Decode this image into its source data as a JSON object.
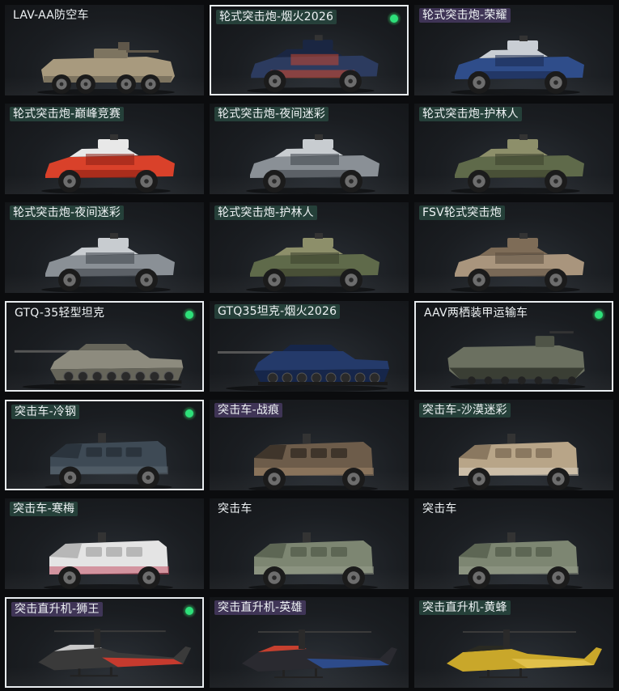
{
  "vehicles": [
    {
      "label": "LAV-AA防空车",
      "tag": "plain",
      "selected": false,
      "equipped": false,
      "type": "apc8",
      "colors": [
        "#a89a7e",
        "#7d7460",
        "#5f574a"
      ]
    },
    {
      "label": "轮式突击炮-烟火2026",
      "tag": "green",
      "selected": true,
      "equipped": true,
      "type": "assault",
      "colors": [
        "#2c3b5f",
        "#1a2642",
        "#c7472f"
      ]
    },
    {
      "label": "轮式突击炮-荣耀",
      "tag": "purple",
      "selected": false,
      "equipped": false,
      "type": "assault",
      "colors": [
        "#2f4d8a",
        "#c9ced4",
        "#1a2a4e"
      ]
    },
    {
      "label": "轮式突击炮-巅峰竞赛",
      "tag": "green",
      "selected": false,
      "equipped": false,
      "type": "assault",
      "colors": [
        "#d9412a",
        "#e8e8e8",
        "#8a1f14"
      ]
    },
    {
      "label": "轮式突击炮-夜间迷彩",
      "tag": "green",
      "selected": false,
      "equipped": false,
      "type": "assault",
      "colors": [
        "#8a9096",
        "#c8ccd0",
        "#3d4248"
      ]
    },
    {
      "label": "轮式突击炮-护林人",
      "tag": "green",
      "selected": false,
      "equipped": false,
      "type": "assault",
      "colors": [
        "#5f6a4a",
        "#8d8f6a",
        "#3a3f2c"
      ]
    },
    {
      "label": "轮式突击炮-夜间迷彩",
      "tag": "green",
      "selected": false,
      "equipped": false,
      "type": "assault",
      "colors": [
        "#8a9096",
        "#c8ccd0",
        "#3d4248"
      ]
    },
    {
      "label": "轮式突击炮-护林人",
      "tag": "green",
      "selected": false,
      "equipped": false,
      "type": "assault",
      "colors": [
        "#5f6a4a",
        "#8d8f6a",
        "#3a3f2c"
      ]
    },
    {
      "label": "FSV轮式突击炮",
      "tag": "green",
      "selected": false,
      "equipped": false,
      "type": "assault",
      "colors": [
        "#a9957d",
        "#7e6c57",
        "#5a4d3e"
      ]
    },
    {
      "label": "GTQ-35轻型坦克",
      "tag": "plain",
      "selected": true,
      "equipped": true,
      "type": "tank",
      "colors": [
        "#8d8b7e",
        "#66655a",
        "#4a4940"
      ]
    },
    {
      "label": "GTQ35坦克-烟火2026",
      "tag": "green",
      "selected": false,
      "equipped": false,
      "type": "tank",
      "colors": [
        "#243a6a",
        "#16264a",
        "#c7472f"
      ]
    },
    {
      "label": "AAV两栖装甲运输车",
      "tag": "plain",
      "selected": true,
      "equipped": true,
      "type": "amphib",
      "colors": [
        "#6b7060",
        "#4f5447",
        "#3a3e34"
      ]
    },
    {
      "label": "突击车-冷钢",
      "tag": "green",
      "selected": true,
      "equipped": true,
      "type": "mrap",
      "colors": [
        "#3e4a55",
        "#2b343d",
        "#5f6b75"
      ]
    },
    {
      "label": "突击车-战痕",
      "tag": "purple",
      "selected": false,
      "equipped": false,
      "type": "mrap",
      "colors": [
        "#6d5c4a",
        "#3f352b",
        "#a58a6c"
      ]
    },
    {
      "label": "突击车-沙漠迷彩",
      "tag": "green",
      "selected": false,
      "equipped": false,
      "type": "mrap",
      "colors": [
        "#b8a588",
        "#8a7860",
        "#e0d8c8"
      ]
    },
    {
      "label": "突击车-寒梅",
      "tag": "green",
      "selected": false,
      "equipped": false,
      "type": "mrap",
      "colors": [
        "#e4e4e4",
        "#b7b7b7",
        "#c2445a"
      ]
    },
    {
      "label": "突击车",
      "tag": "plain",
      "selected": false,
      "equipped": false,
      "type": "mrap",
      "colors": [
        "#7d8672",
        "#5d6654",
        "#9aa08e"
      ]
    },
    {
      "label": "突击车",
      "tag": "plain",
      "selected": false,
      "equipped": false,
      "type": "mrap",
      "colors": [
        "#7d8672",
        "#5d6654",
        "#9aa08e"
      ]
    },
    {
      "label": "突击直升机-狮王",
      "tag": "purple",
      "selected": true,
      "equipped": true,
      "type": "heli",
      "colors": [
        "#3a3a3a",
        "#c9c9c9",
        "#c53a2e"
      ]
    },
    {
      "label": "突击直升机-英雄",
      "tag": "purple",
      "selected": false,
      "equipped": false,
      "type": "heli",
      "colors": [
        "#2a2a30",
        "#c5402f",
        "#2d4b8a"
      ]
    },
    {
      "label": "突击直升机-黄蜂",
      "tag": "green",
      "selected": false,
      "equipped": false,
      "type": "heli",
      "colors": [
        "#c9a72a",
        "#2a2a22",
        "#e0c04a"
      ]
    }
  ]
}
